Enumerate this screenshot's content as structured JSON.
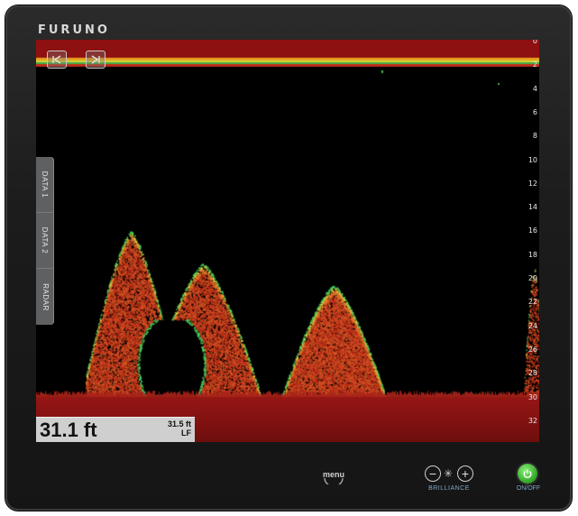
{
  "device": {
    "brand": "FURUNO"
  },
  "side_tabs": [
    {
      "label": "DATA 1"
    },
    {
      "label": "DATA 2"
    },
    {
      "label": "RADAR"
    }
  ],
  "depth": {
    "main": "31.1 ft",
    "secondary": "31.5 ft",
    "frequency": "LF"
  },
  "scale": {
    "labels": [
      "0",
      "2",
      "4",
      "6",
      "8",
      "10",
      "12",
      "14",
      "16",
      "18",
      "20",
      "22",
      "24",
      "26",
      "28",
      "30",
      "32"
    ]
  },
  "controls": {
    "menu_label": "menu",
    "brilliance_minus": "−",
    "brilliance_plus": "+",
    "brilliance_symbol": "✳",
    "brilliance_label": "BRILLIANCE",
    "power_label": "ON/OFF"
  },
  "icons": {
    "top_left": "collapse-left-icon",
    "top_right": "expand-right-icon"
  },
  "colors": {
    "echo_strong": "#b52a1a",
    "echo_mid": "#e07a2a",
    "echo_edge": "#5ad36a",
    "bottom": "#8a1414",
    "power": "#3fbf35"
  }
}
